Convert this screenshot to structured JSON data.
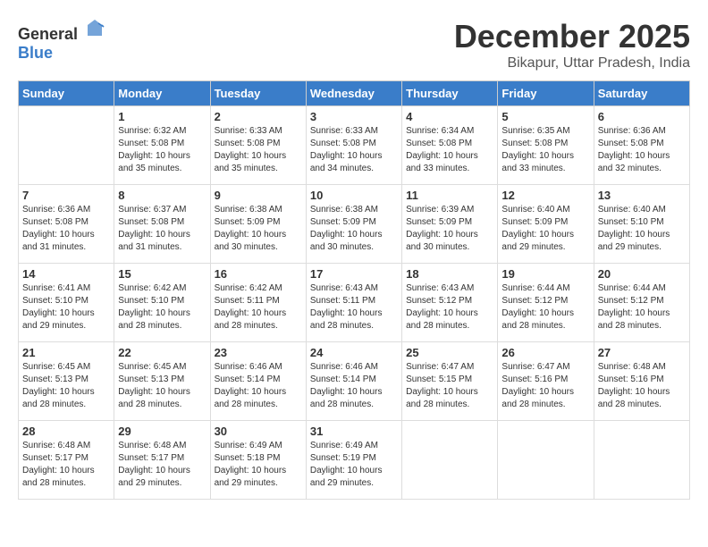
{
  "logo": {
    "general": "General",
    "blue": "Blue"
  },
  "header": {
    "month": "December 2025",
    "location": "Bikapur, Uttar Pradesh, India"
  },
  "weekdays": [
    "Sunday",
    "Monday",
    "Tuesday",
    "Wednesday",
    "Thursday",
    "Friday",
    "Saturday"
  ],
  "weeks": [
    [
      {
        "day": "",
        "sunrise": "",
        "sunset": "",
        "daylight": ""
      },
      {
        "day": "1",
        "sunrise": "Sunrise: 6:32 AM",
        "sunset": "Sunset: 5:08 PM",
        "daylight": "Daylight: 10 hours and 35 minutes."
      },
      {
        "day": "2",
        "sunrise": "Sunrise: 6:33 AM",
        "sunset": "Sunset: 5:08 PM",
        "daylight": "Daylight: 10 hours and 35 minutes."
      },
      {
        "day": "3",
        "sunrise": "Sunrise: 6:33 AM",
        "sunset": "Sunset: 5:08 PM",
        "daylight": "Daylight: 10 hours and 34 minutes."
      },
      {
        "day": "4",
        "sunrise": "Sunrise: 6:34 AM",
        "sunset": "Sunset: 5:08 PM",
        "daylight": "Daylight: 10 hours and 33 minutes."
      },
      {
        "day": "5",
        "sunrise": "Sunrise: 6:35 AM",
        "sunset": "Sunset: 5:08 PM",
        "daylight": "Daylight: 10 hours and 33 minutes."
      },
      {
        "day": "6",
        "sunrise": "Sunrise: 6:36 AM",
        "sunset": "Sunset: 5:08 PM",
        "daylight": "Daylight: 10 hours and 32 minutes."
      }
    ],
    [
      {
        "day": "7",
        "sunrise": "Sunrise: 6:36 AM",
        "sunset": "Sunset: 5:08 PM",
        "daylight": "Daylight: 10 hours and 31 minutes."
      },
      {
        "day": "8",
        "sunrise": "Sunrise: 6:37 AM",
        "sunset": "Sunset: 5:08 PM",
        "daylight": "Daylight: 10 hours and 31 minutes."
      },
      {
        "day": "9",
        "sunrise": "Sunrise: 6:38 AM",
        "sunset": "Sunset: 5:09 PM",
        "daylight": "Daylight: 10 hours and 30 minutes."
      },
      {
        "day": "10",
        "sunrise": "Sunrise: 6:38 AM",
        "sunset": "Sunset: 5:09 PM",
        "daylight": "Daylight: 10 hours and 30 minutes."
      },
      {
        "day": "11",
        "sunrise": "Sunrise: 6:39 AM",
        "sunset": "Sunset: 5:09 PM",
        "daylight": "Daylight: 10 hours and 30 minutes."
      },
      {
        "day": "12",
        "sunrise": "Sunrise: 6:40 AM",
        "sunset": "Sunset: 5:09 PM",
        "daylight": "Daylight: 10 hours and 29 minutes."
      },
      {
        "day": "13",
        "sunrise": "Sunrise: 6:40 AM",
        "sunset": "Sunset: 5:10 PM",
        "daylight": "Daylight: 10 hours and 29 minutes."
      }
    ],
    [
      {
        "day": "14",
        "sunrise": "Sunrise: 6:41 AM",
        "sunset": "Sunset: 5:10 PM",
        "daylight": "Daylight: 10 hours and 29 minutes."
      },
      {
        "day": "15",
        "sunrise": "Sunrise: 6:42 AM",
        "sunset": "Sunset: 5:10 PM",
        "daylight": "Daylight: 10 hours and 28 minutes."
      },
      {
        "day": "16",
        "sunrise": "Sunrise: 6:42 AM",
        "sunset": "Sunset: 5:11 PM",
        "daylight": "Daylight: 10 hours and 28 minutes."
      },
      {
        "day": "17",
        "sunrise": "Sunrise: 6:43 AM",
        "sunset": "Sunset: 5:11 PM",
        "daylight": "Daylight: 10 hours and 28 minutes."
      },
      {
        "day": "18",
        "sunrise": "Sunrise: 6:43 AM",
        "sunset": "Sunset: 5:12 PM",
        "daylight": "Daylight: 10 hours and 28 minutes."
      },
      {
        "day": "19",
        "sunrise": "Sunrise: 6:44 AM",
        "sunset": "Sunset: 5:12 PM",
        "daylight": "Daylight: 10 hours and 28 minutes."
      },
      {
        "day": "20",
        "sunrise": "Sunrise: 6:44 AM",
        "sunset": "Sunset: 5:12 PM",
        "daylight": "Daylight: 10 hours and 28 minutes."
      }
    ],
    [
      {
        "day": "21",
        "sunrise": "Sunrise: 6:45 AM",
        "sunset": "Sunset: 5:13 PM",
        "daylight": "Daylight: 10 hours and 28 minutes."
      },
      {
        "day": "22",
        "sunrise": "Sunrise: 6:45 AM",
        "sunset": "Sunset: 5:13 PM",
        "daylight": "Daylight: 10 hours and 28 minutes."
      },
      {
        "day": "23",
        "sunrise": "Sunrise: 6:46 AM",
        "sunset": "Sunset: 5:14 PM",
        "daylight": "Daylight: 10 hours and 28 minutes."
      },
      {
        "day": "24",
        "sunrise": "Sunrise: 6:46 AM",
        "sunset": "Sunset: 5:14 PM",
        "daylight": "Daylight: 10 hours and 28 minutes."
      },
      {
        "day": "25",
        "sunrise": "Sunrise: 6:47 AM",
        "sunset": "Sunset: 5:15 PM",
        "daylight": "Daylight: 10 hours and 28 minutes."
      },
      {
        "day": "26",
        "sunrise": "Sunrise: 6:47 AM",
        "sunset": "Sunset: 5:16 PM",
        "daylight": "Daylight: 10 hours and 28 minutes."
      },
      {
        "day": "27",
        "sunrise": "Sunrise: 6:48 AM",
        "sunset": "Sunset: 5:16 PM",
        "daylight": "Daylight: 10 hours and 28 minutes."
      }
    ],
    [
      {
        "day": "28",
        "sunrise": "Sunrise: 6:48 AM",
        "sunset": "Sunset: 5:17 PM",
        "daylight": "Daylight: 10 hours and 28 minutes."
      },
      {
        "day": "29",
        "sunrise": "Sunrise: 6:48 AM",
        "sunset": "Sunset: 5:17 PM",
        "daylight": "Daylight: 10 hours and 29 minutes."
      },
      {
        "day": "30",
        "sunrise": "Sunrise: 6:49 AM",
        "sunset": "Sunset: 5:18 PM",
        "daylight": "Daylight: 10 hours and 29 minutes."
      },
      {
        "day": "31",
        "sunrise": "Sunrise: 6:49 AM",
        "sunset": "Sunset: 5:19 PM",
        "daylight": "Daylight: 10 hours and 29 minutes."
      },
      {
        "day": "",
        "sunrise": "",
        "sunset": "",
        "daylight": ""
      },
      {
        "day": "",
        "sunrise": "",
        "sunset": "",
        "daylight": ""
      },
      {
        "day": "",
        "sunrise": "",
        "sunset": "",
        "daylight": ""
      }
    ]
  ]
}
